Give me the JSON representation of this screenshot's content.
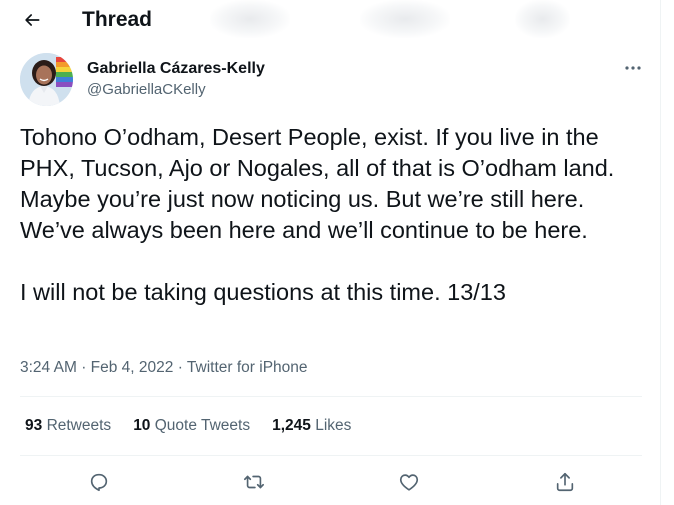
{
  "header": {
    "title": "Thread",
    "back_icon": "arrow-left-icon"
  },
  "author": {
    "name": "Gabriella Cázares-Kelly",
    "handle": "@GabriellaCKelly",
    "more_icon": "more-horizontal-icon"
  },
  "tweet": {
    "paragraphs": [
      "Tohono O’odham, Desert People, exist. If you live in the PHX, Tucson, Ajo or Nogales, all of that is O’odham land. Maybe you’re just now noticing us. But we’re still here. We’ve always been here and we’ll continue to be here.",
      "I will not be taking questions at this time. 13/13"
    ]
  },
  "meta": {
    "time": "3:24 AM",
    "separator": "·",
    "date": "Feb 4, 2022",
    "source": "Twitter for iPhone"
  },
  "stats": {
    "retweets": {
      "count": "93",
      "label": "Retweets"
    },
    "quote_tweets": {
      "count": "10",
      "label": "Quote Tweets"
    },
    "likes": {
      "count": "1,245",
      "label": "Likes"
    }
  },
  "actions": {
    "reply_icon": "reply-icon",
    "retweet_icon": "retweet-icon",
    "like_icon": "heart-icon",
    "share_icon": "share-icon"
  },
  "colors": {
    "text_primary": "#0f1419",
    "text_secondary": "#536471",
    "divider": "#eff3f4",
    "background": "#ffffff"
  }
}
